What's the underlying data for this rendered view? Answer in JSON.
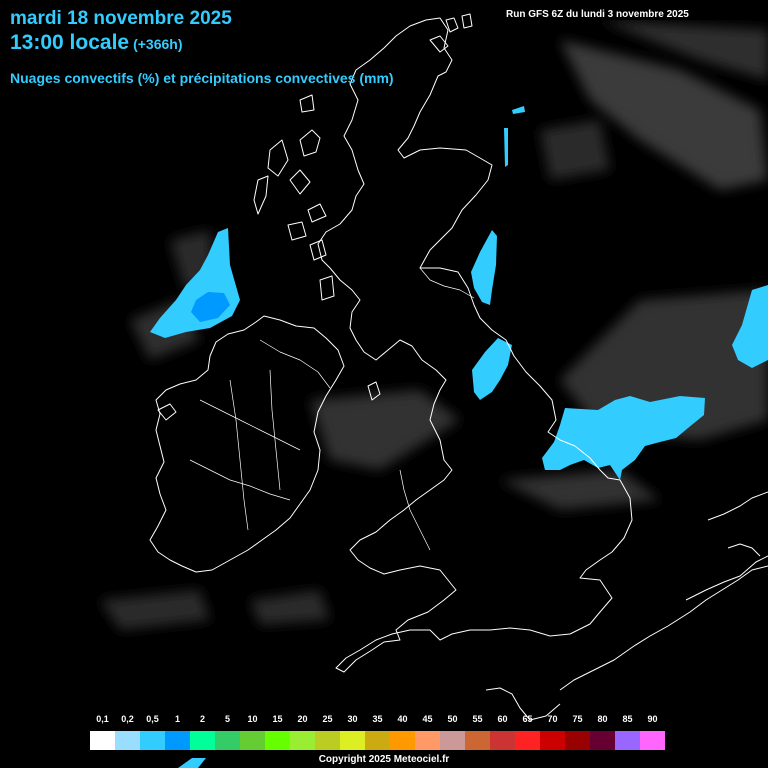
{
  "header": {
    "date": "mardi 18 novembre 2025",
    "time": "13:00 locale",
    "lead": "(+366h)",
    "product": "Nuages convectifs (%) et précipitations convectives (mm)",
    "run": "Run GFS 6Z du lundi 3 novembre 2025"
  },
  "legend": {
    "labels": [
      "0,1",
      "0,2",
      "0,5",
      "1",
      "2",
      "5",
      "10",
      "15",
      "20",
      "25",
      "30",
      "35",
      "40",
      "45",
      "50",
      "55",
      "60",
      "65",
      "70",
      "75",
      "80",
      "85",
      "90"
    ],
    "colors": [
      "#ffffff",
      "#99ddff",
      "#33ccff",
      "#0099ff",
      "#00ff99",
      "#33cc66",
      "#66cc33",
      "#66ff00",
      "#99ee33",
      "#bbcc22",
      "#ddee22",
      "#ccaa11",
      "#ff9900",
      "#ff9966",
      "#cc9999",
      "#cc6633",
      "#cc3333",
      "#ff2222",
      "#cc0000",
      "#990000",
      "#660033",
      "#9966ff",
      "#ff66ff"
    ]
  },
  "precip_color": "#33ccff",
  "precip_core_color": "#0099ff",
  "coast_color": "#ffffff",
  "copyright": "Copyright 2025 Meteociel.fr"
}
